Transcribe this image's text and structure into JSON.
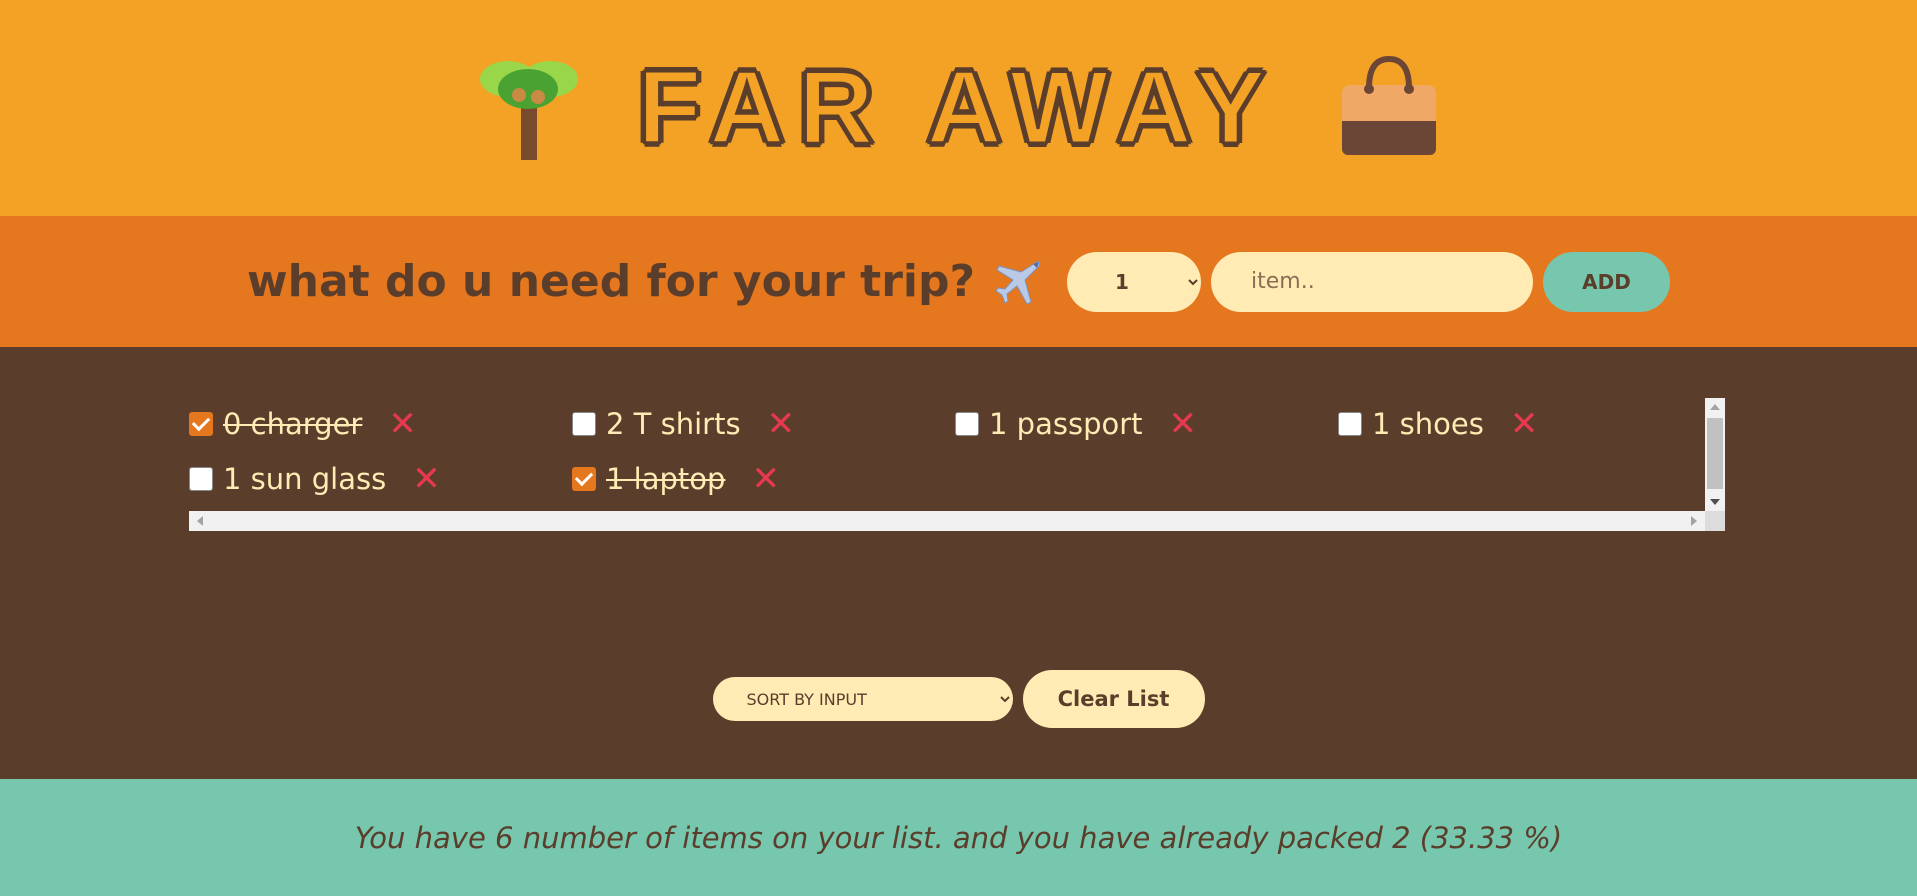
{
  "header": {
    "title": "FAR AWAY",
    "left_icon": "palm-tree-icon",
    "right_icon": "handbag-icon"
  },
  "form": {
    "question": "what do u need for your trip?",
    "plane_icon": "airplane-icon",
    "quantity_value": "1",
    "item_placeholder": "item..",
    "add_label": "ADD"
  },
  "items": [
    {
      "label": "0 charger",
      "packed": true
    },
    {
      "label": "2 T shirts",
      "packed": false
    },
    {
      "label": "1 passport",
      "packed": false
    },
    {
      "label": "1 shoes",
      "packed": false
    },
    {
      "label": "1 sun glass",
      "packed": false
    },
    {
      "label": "1 laptop",
      "packed": true
    }
  ],
  "delete_glyph": "✕",
  "actions": {
    "sort_value": "SORT BY INPUT",
    "clear_label": "Clear List"
  },
  "stats": {
    "text": "You have 6 number of items on your list. and you have already packed 2 (33.33 %)"
  },
  "colors": {
    "header": "#f4a226",
    "form": "#e5771e",
    "list": "#5a3e2b",
    "stats": "#76c7ad",
    "cream": "#ffebb3",
    "delete": "#e8384f"
  }
}
